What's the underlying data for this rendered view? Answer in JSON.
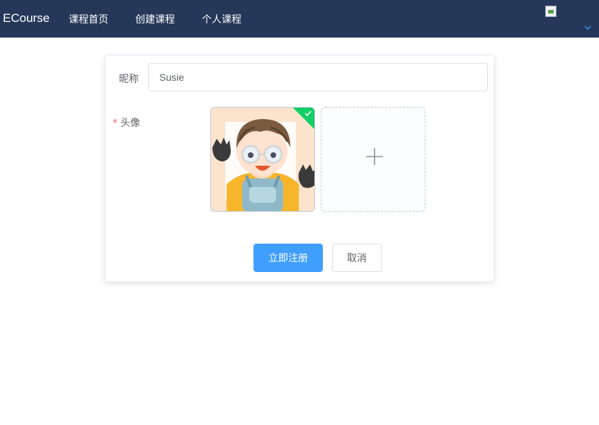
{
  "nav": {
    "brand": "ECourse",
    "items": [
      {
        "label": "课程首页"
      },
      {
        "label": "创建课程"
      },
      {
        "label": "个人课程"
      }
    ]
  },
  "form": {
    "nickname_label": "昵称",
    "nickname_value": "Susie",
    "avatar_required_mark": "*",
    "avatar_label": "头像",
    "submit_label": "立即注册",
    "cancel_label": "取消"
  },
  "icons": {
    "broken_image": "broken-image-icon",
    "dropdown": "chevron-down-icon",
    "success": "check-icon",
    "add": "plus-icon"
  },
  "colors": {
    "nav_bg": "#263859",
    "primary": "#409eff",
    "success": "#13ce66",
    "required": "#f56c6c",
    "dropdown": "#409eff"
  }
}
